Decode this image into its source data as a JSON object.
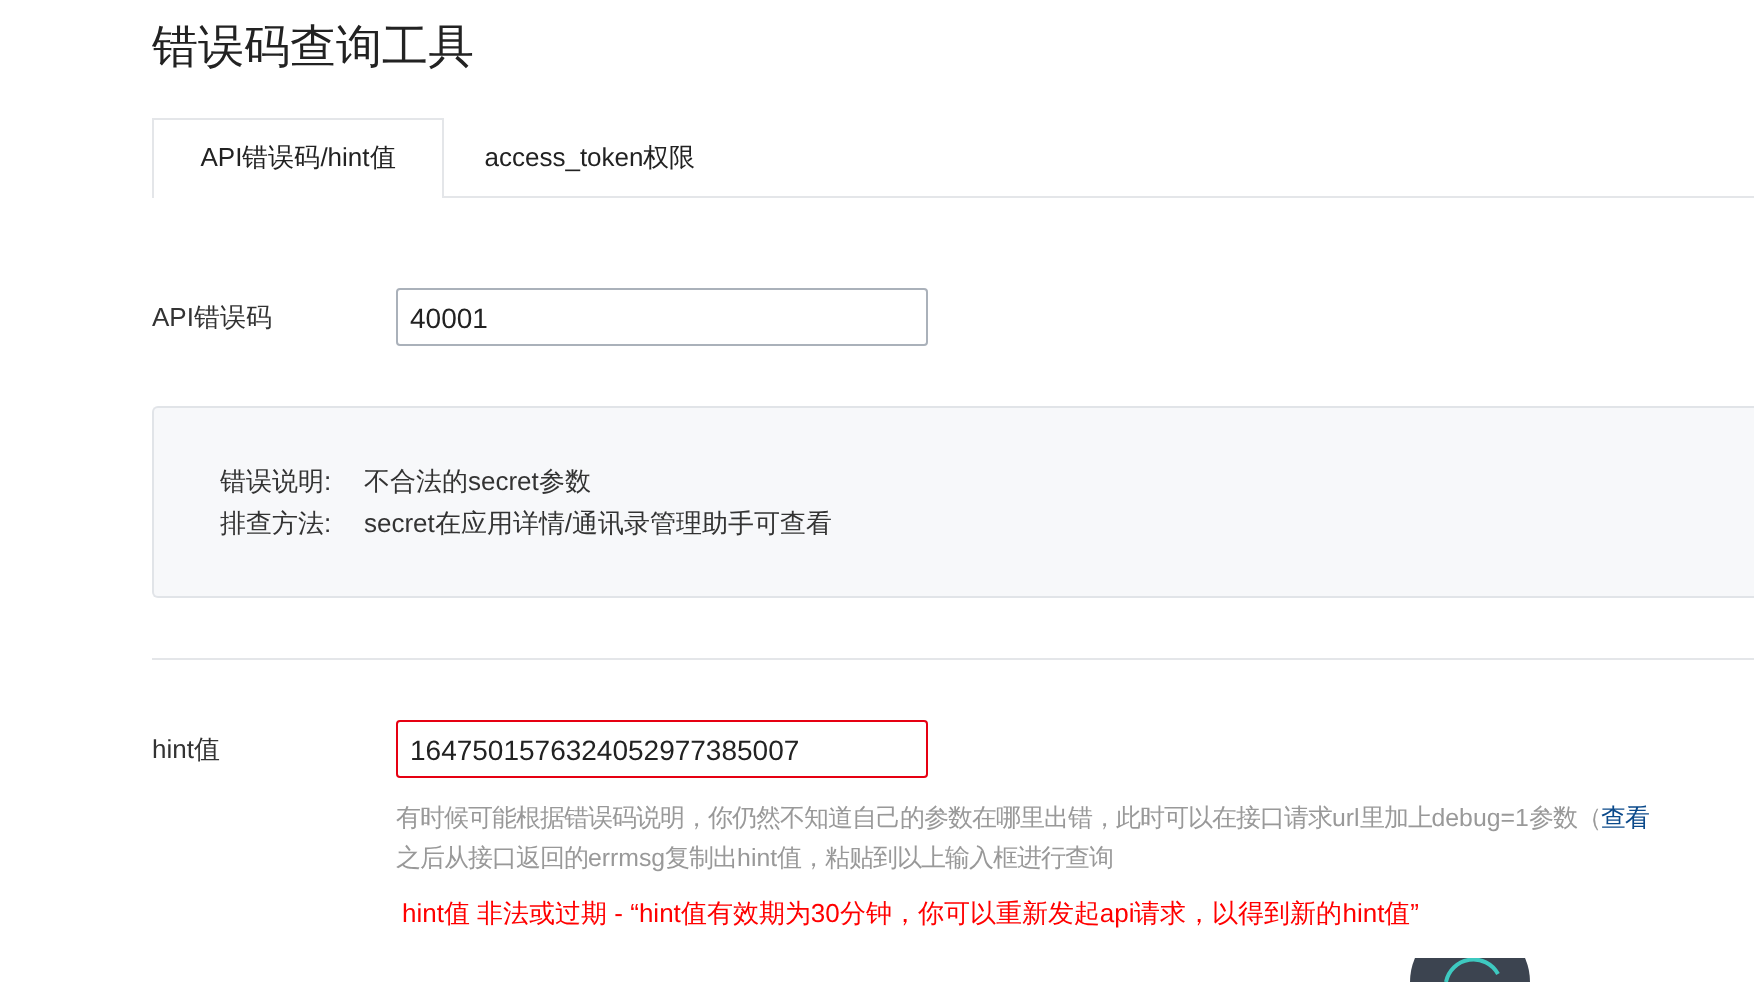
{
  "title": "错误码查询工具",
  "tabs": [
    {
      "label": "API错误码/hint值",
      "selected": true
    },
    {
      "label": "access_token权限",
      "selected": false
    }
  ],
  "error_code": {
    "label": "API错误码",
    "value": "40001",
    "invalid": false
  },
  "result": [
    {
      "label": "错误说明:",
      "value": "不合法的secret参数"
    },
    {
      "label": "排查方法:",
      "value": "secret在应用详情/通讯录管理助手可查看"
    }
  ],
  "hint": {
    "label": "hint值",
    "value": "1647501576324052977385007",
    "invalid": true,
    "help_line_1": "有时候可能根据错误码说明，你仍然不知道自己的参数在哪里出错，此时可以在接口请求url里加上debug=1参数（",
    "help_link": "查看",
    "help_line_2": "之后从接口返回的errmsg复制出hint值，粘贴到以上输入框进行查询",
    "error": "hint值 非法或过期 - “hint值有效期为30分钟，你可以重新发起api请求，以得到新的hint值”"
  }
}
